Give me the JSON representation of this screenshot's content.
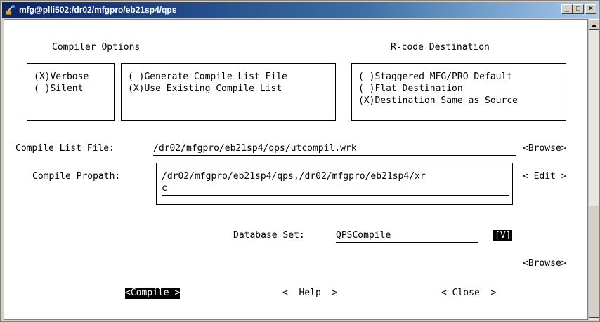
{
  "window": {
    "title": "mfg@plli502:/dr02/mfgpro/eb21sp4/qps"
  },
  "title_buttons": {
    "minimize": "_",
    "maximize": "□",
    "close": "×"
  },
  "headers": {
    "compiler_options": "Compiler Options",
    "rcode_destination": "R-code Destination"
  },
  "output_mode": {
    "verbose": "(X)Verbose",
    "silent": "( )Silent"
  },
  "compile_list_mode": {
    "generate": "( )Generate Compile List File",
    "use_existing": "(X)Use Existing Compile List"
  },
  "rcode_dest": {
    "staggered": "( )Staggered MFG/PRO Default",
    "flat": "( )Flat Destination",
    "same_as_source": "(X)Destination Same as Source"
  },
  "compile_list_file": {
    "label": "Compile List File:",
    "value": "/dr02/mfgpro/eb21sp4/qps/utcompil.wrk",
    "browse": "<Browse>"
  },
  "compile_propath": {
    "label": "Compile Propath:",
    "value_line1": "/dr02/mfgpro/eb21sp4/qps,/dr02/mfgpro/eb21sp4/xr",
    "value_line2": "c",
    "edit": "< Edit >"
  },
  "database_set": {
    "label": "Database Set:",
    "value": "QPSCompile",
    "dropdown": "[V]"
  },
  "browse2": "<Browse>",
  "actions": {
    "compile": "<Compile >",
    "help": "<  Help  >",
    "close": "< Close  >"
  }
}
